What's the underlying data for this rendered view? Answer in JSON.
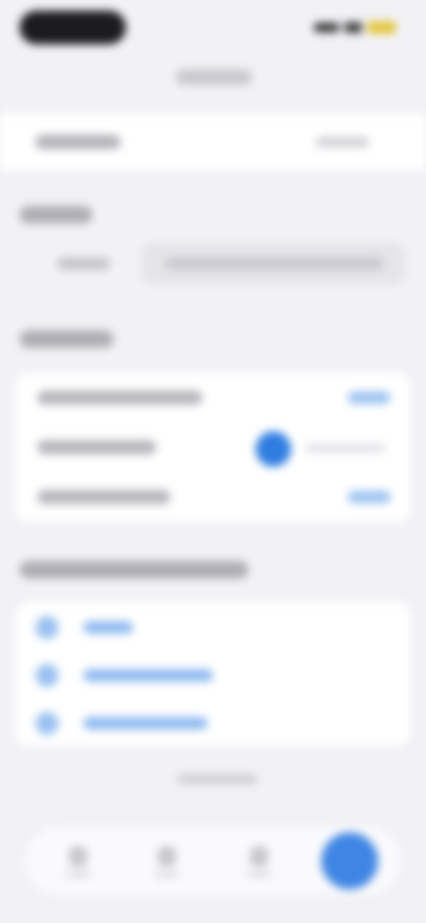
{
  "colors": {
    "background": "#f2f2f6",
    "card": "#ffffff",
    "accent": "#2f7de0",
    "accent_light": "#9cc3f1",
    "status_dark": "#1c1c1e",
    "battery": "#e3c53a"
  },
  "status_bar": {
    "icons": [
      "signal-icon",
      "wifi-icon",
      "battery-icon"
    ]
  },
  "toggle": {
    "state": "on"
  },
  "links": {
    "icons": [
      "link-icon",
      "link-icon",
      "link-icon"
    ]
  },
  "tabbar": {
    "icons": [
      "tab-icon",
      "tab-icon",
      "tab-icon",
      "tab-icon"
    ],
    "active_index": 3
  }
}
